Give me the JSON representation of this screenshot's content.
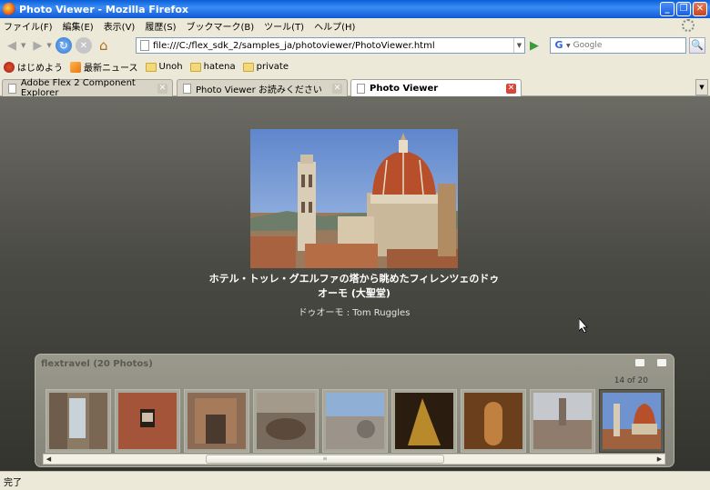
{
  "window": {
    "title": "Photo Viewer - Mozilla Firefox"
  },
  "menu": [
    "ファイル(F)",
    "編集(E)",
    "表示(V)",
    "履歴(S)",
    "ブックマーク(B)",
    "ツール(T)",
    "ヘルプ(H)"
  ],
  "nav": {
    "url": "file:///C:/flex_sdk_2/samples_ja/photoviewer/PhotoViewer.html",
    "search_placeholder": "Google"
  },
  "bookmarks": [
    "はじめよう",
    "最新ニュース",
    "Unoh",
    "hatena",
    "private"
  ],
  "tabs": [
    "Adobe Flex 2 Component Explorer",
    "Photo Viewer お読みください",
    "Photo Viewer"
  ],
  "photo": {
    "caption": "ホテル・トッレ・グエルファの塔から眺めたフィレンツェのドゥオーモ (大聖堂)",
    "credit": "ドゥオーモ : Tom Ruggles"
  },
  "gallery": {
    "title": "flextravel (20 Photos)",
    "counter": "14 of 20",
    "thumbnails": [
      "waterfall",
      "window-wall",
      "ruined-door",
      "old-car",
      "stone-sphere",
      "golden-sculpture",
      "arched-corridor",
      "city-panorama",
      "florence-duomo"
    ],
    "selected_index": 8
  },
  "status": {
    "text": "完了"
  },
  "colors": {
    "titlebar": "#0A5FD8",
    "content_bg": "#4a4a44",
    "panel_bg": "#8f8e83",
    "active_tab_close": "#d9463a"
  }
}
